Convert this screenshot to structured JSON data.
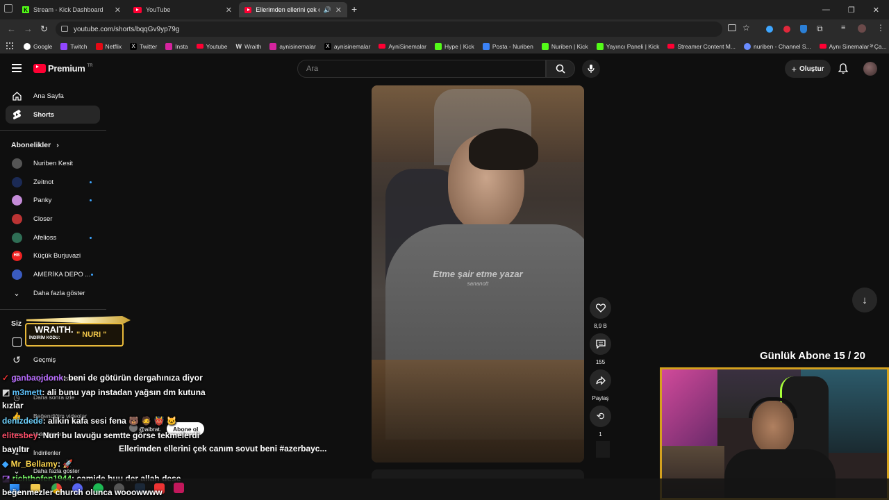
{
  "browser": {
    "tabs": [
      {
        "title": "Stream - Kick Dashboard"
      },
      {
        "title": "YouTube"
      },
      {
        "title": "Ellerimden ellerini çek canı"
      }
    ],
    "url": "youtube.com/shorts/bqqGv9yp79g",
    "bookmarks": [
      "Google",
      "Twitch",
      "Netflix",
      "Twitter",
      "Insta",
      "Youtube",
      "Wraith",
      "aynisinemalar",
      "aynisinemalar",
      "AyniSinemalar",
      "Hype | Kick",
      "Posta - Nuriben",
      "Nuriben | Kick",
      "Yayıncı Paneli | Kick",
      "Streamer Content M...",
      "nuriben - Channel S...",
      "Aynı Sinemalar - Ça..."
    ]
  },
  "youtube": {
    "logo": "Premium",
    "logo_region": "TR",
    "search_placeholder": "Ara",
    "create_label": "Oluştur",
    "sidebar": {
      "home": "Ana Sayfa",
      "shorts": "Shorts",
      "subs_header": "Abonelikler",
      "channels": [
        {
          "name": "Nuriben Kesit",
          "color": "#555"
        },
        {
          "name": "Zeitnot",
          "color": "#1b2a55"
        },
        {
          "name": "Panky",
          "color": "#c48bd8"
        },
        {
          "name": "Closer",
          "color": "#b33"
        },
        {
          "name": "Afelioss",
          "color": "#2f6e55"
        },
        {
          "name": "Küçük Burjuvazi",
          "color": "#e22"
        },
        {
          "name": "AMERİKA DEPO ...",
          "color": "#3a5bbf"
        }
      ],
      "show_more": "Daha fazla göster",
      "you_header": "Siz",
      "history": "Geçmiş",
      "playlists": "Oynatma listeleri",
      "watch_later": "Daha sonra izle",
      "liked": "Beğendiğim videolar",
      "your_videos": "Videolarınız",
      "downloads": "İndirilenler",
      "show_more2": "Daha fazla göster"
    },
    "short": {
      "caption": "Etme şair etme yazar",
      "caption_sub": "sananott",
      "channel": "@aibrat.",
      "subscribe": "Abone ol",
      "title": "Ellerimden ellerini çek canım sovut beni #azerbayc...",
      "likes": "8,9 B",
      "comments": "155",
      "share": "Paylaş",
      "remix": "1"
    }
  },
  "overlay": {
    "sponsor_name": "WRAITH.",
    "sponsor_code_label": "İNDİRİM KODU:",
    "sponsor_code": "\" NURI \"",
    "sub_goal": "Günlük Abone 15 / 20",
    "chat": [
      {
        "user": "ganbaojdonk",
        "color": "#b86bff",
        "msg": ": beni de götürün dergahınıza diyor"
      },
      {
        "user": "m3mett",
        "color": "#5fc5ff",
        "msg": ": ali bunu yap instadan yağsın dm kutuna"
      },
      {
        "user": "",
        "color": "#fff",
        "msg": "kızlar"
      },
      {
        "user": "denizdede",
        "color": "#6fd3ff",
        "msg": ": alikin kafa sesi fena"
      },
      {
        "user": "elitesbey",
        "color": "#ff4f6a",
        "msg": ": Nuri bu lavuğu semtte görse tekmelerdi"
      },
      {
        "user": "",
        "color": "#fff",
        "msg": "bayıltır"
      },
      {
        "user": "Mr_Bellamy",
        "color": "#ffd84f",
        "msg": ":"
      },
      {
        "user": "richthofen1944",
        "color": "#7cff6b",
        "msg": ": camide huu der allah dese"
      },
      {
        "user": "",
        "color": "#fff",
        "msg": "beğenmezler church olunca wooowwww"
      }
    ]
  }
}
